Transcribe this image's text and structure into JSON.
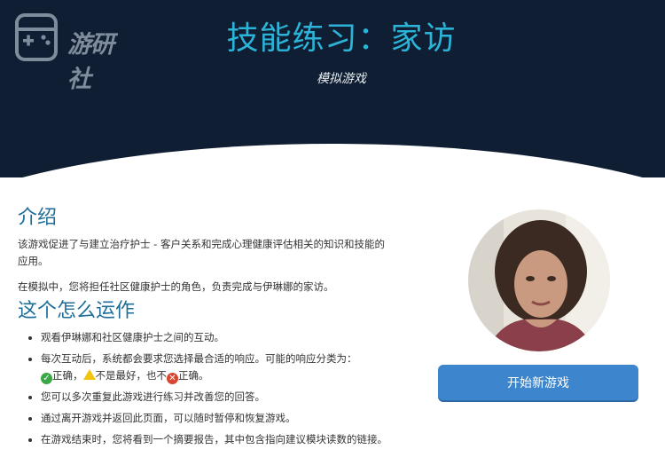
{
  "header": {
    "logo_text": "游研社",
    "title": "技能练习：家访",
    "subtitle": "模拟游戏"
  },
  "intro": {
    "heading": "介绍",
    "paragraphs": [
      "该游戏促进了与建立治疗护士 - 客户关系和完成心理健康评估相关的知识和技能的应用。",
      "在模拟中，您将担任社区健康护士的角色，负责完成与伊琳娜的家访。"
    ]
  },
  "how": {
    "heading": "这个怎么运作",
    "items": [
      "观看伊琳娜和社区健康护士之间的互动。",
      "每次互动后，系统都会要求您选择最合适的响应。可能的响应分类为：",
      "您可以多次重复此游戏进行练习并改善您的回答。",
      "通过离开游戏并返回此页面，可以随时暂停和恢复游戏。",
      "在游戏结束时，您将看到一个摘要报告，其中包含指向建议模块读数的链接。"
    ],
    "response_types": {
      "correct": "正确，",
      "not_best": "不是最好，",
      "not_prefix": "也不",
      "incorrect": "正确。"
    }
  },
  "actions": {
    "start_label": "开始新游戏"
  },
  "colors": {
    "header_bg": "#0f1e33",
    "title": "#2bb4d8",
    "heading": "#1f6e9a",
    "button": "#3d85cc"
  }
}
